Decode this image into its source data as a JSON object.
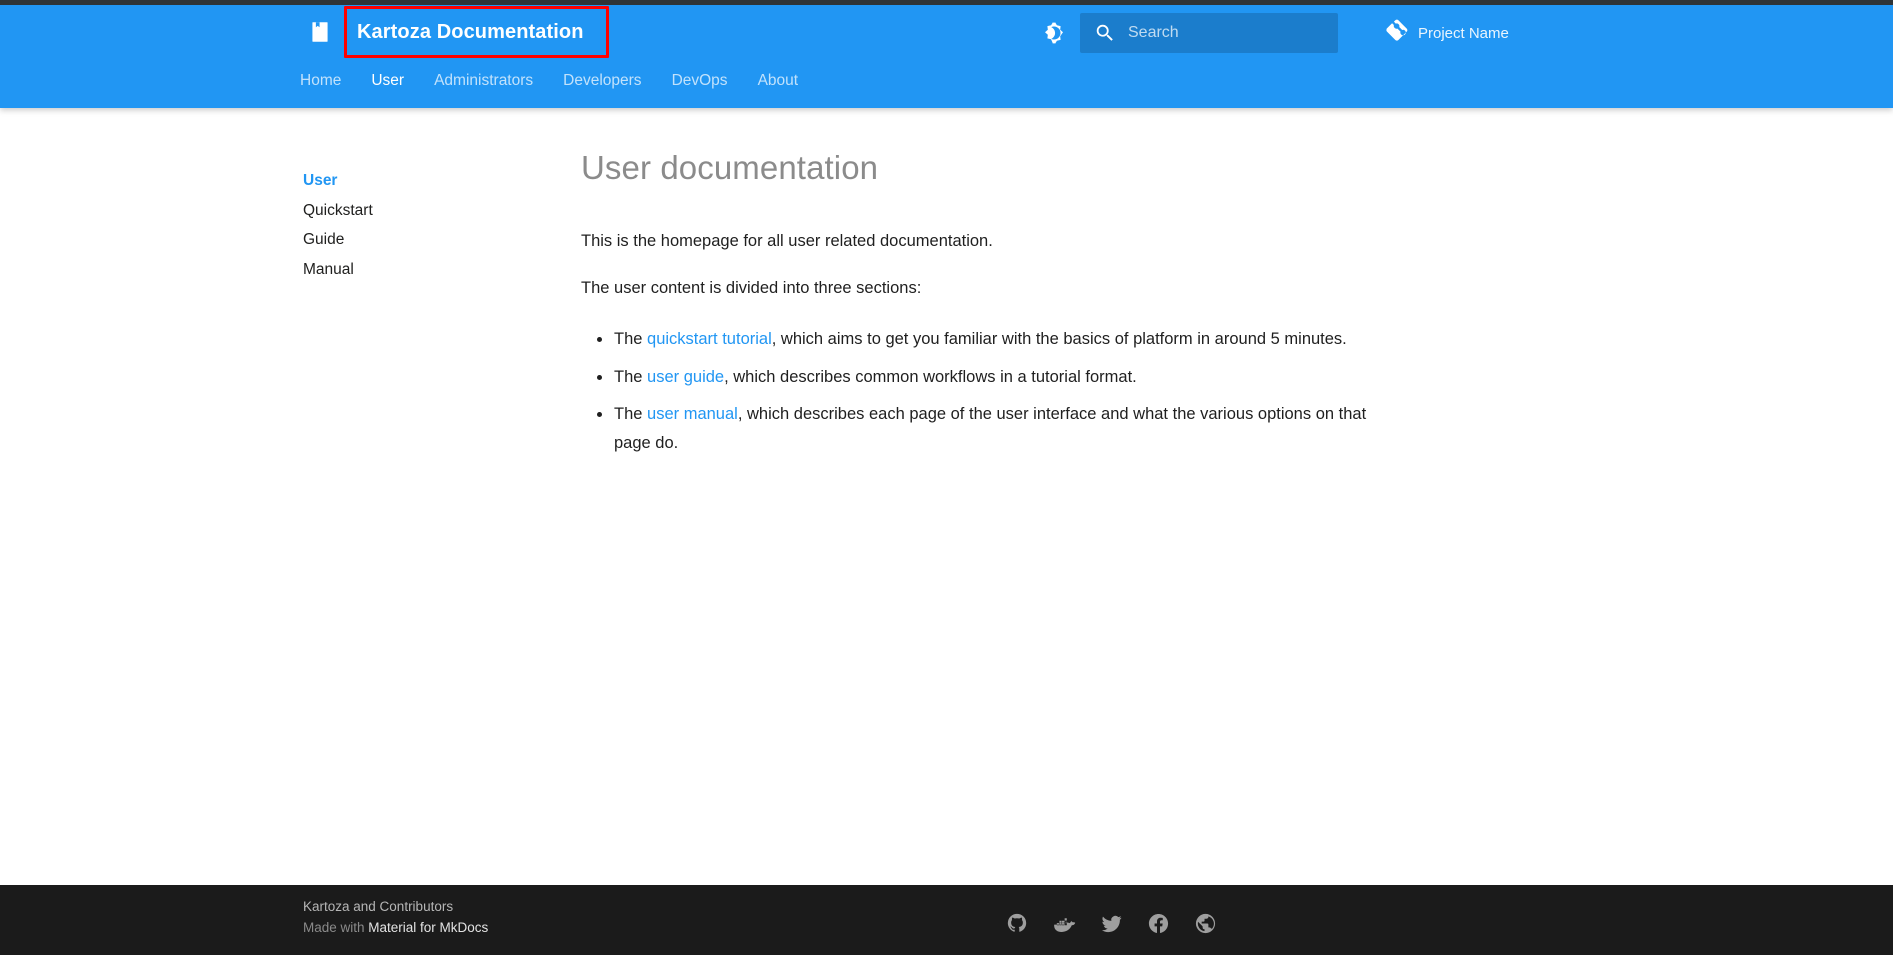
{
  "header": {
    "logo_icon": "book-bookmark-icon",
    "site_title": "Kartoza Documentation",
    "theme_toggle_icon": "brightness-dark-mode-icon",
    "search": {
      "icon": "search-icon",
      "placeholder": "Search",
      "value": ""
    },
    "repo": {
      "icon": "git-repository-icon",
      "label": "Project Name"
    },
    "tabs": [
      {
        "label": "Home",
        "active": false
      },
      {
        "label": "User",
        "active": true
      },
      {
        "label": "Administrators",
        "active": false
      },
      {
        "label": "Developers",
        "active": false
      },
      {
        "label": "DevOps",
        "active": false
      },
      {
        "label": "About",
        "active": false
      }
    ],
    "accent_color": "#2196f3",
    "annotation_color": "#ff0000"
  },
  "sidebar": {
    "items": [
      {
        "label": "User",
        "active": true
      },
      {
        "label": "Quickstart",
        "active": false
      },
      {
        "label": "Guide",
        "active": false
      },
      {
        "label": "Manual",
        "active": false
      }
    ]
  },
  "main": {
    "heading": "User documentation",
    "paragraph_1": "This is the homepage for all user related documentation.",
    "paragraph_2": "The user content is divided into three sections:",
    "bullets": [
      {
        "prefix": "The ",
        "link": "quickstart tutorial",
        "suffix": ", which aims to get you familiar with the basics of platform in around 5 minutes."
      },
      {
        "prefix": "The ",
        "link": "user guide",
        "suffix": ", which describes common workflows in a tutorial format."
      },
      {
        "prefix": "The ",
        "link": "user manual",
        "suffix": ", which describes each page of the user interface and what the various options on that page do."
      }
    ],
    "link_color": "#2196f3"
  },
  "footer": {
    "copyright": "Kartoza and Contributors",
    "made_with_prefix": "Made with ",
    "made_with_brand": "Material for MkDocs",
    "social_icons": [
      "github-icon",
      "docker-icon",
      "twitter-icon",
      "facebook-icon",
      "globe-icon"
    ],
    "background_color": "#1b1b1b"
  }
}
